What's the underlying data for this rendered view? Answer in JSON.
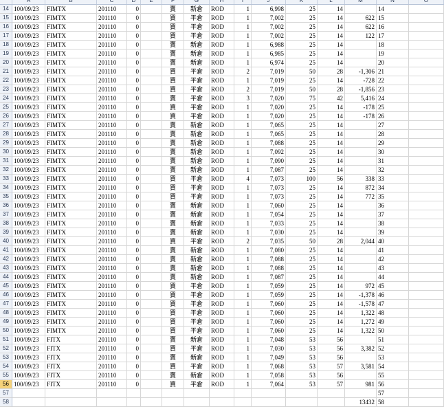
{
  "columns": [
    "A",
    "B",
    "C",
    "D",
    "E",
    "F",
    "G",
    "H",
    "I",
    "J",
    "K",
    "L",
    "M",
    "N",
    "O"
  ],
  "rows": [
    {
      "n": "14",
      "a": "100/09/23",
      "b": "FIMTX",
      "c": "201110",
      "d": "0",
      "f": "賣",
      "g": "新倉",
      "h": "ROD",
      "i": "1",
      "j": "6,998",
      "k": "25",
      "l": "14",
      "m": ""
    },
    {
      "n": "15",
      "a": "100/09/23",
      "b": "FIMTX",
      "c": "201110",
      "d": "0",
      "f": "買",
      "g": "平倉",
      "h": "ROD",
      "i": "1",
      "j": "7,002",
      "k": "25",
      "l": "14",
      "m": "622"
    },
    {
      "n": "16",
      "a": "100/09/23",
      "b": "FIMTX",
      "c": "201110",
      "d": "0",
      "f": "買",
      "g": "平倉",
      "h": "ROD",
      "i": "1",
      "j": "7,002",
      "k": "25",
      "l": "14",
      "m": "622"
    },
    {
      "n": "17",
      "a": "100/09/23",
      "b": "FIMTX",
      "c": "201110",
      "d": "0",
      "f": "買",
      "g": "平倉",
      "h": "ROD",
      "i": "1",
      "j": "7,002",
      "k": "25",
      "l": "14",
      "m": "122"
    },
    {
      "n": "18",
      "a": "100/09/23",
      "b": "FIMTX",
      "c": "201110",
      "d": "0",
      "f": "賣",
      "g": "新倉",
      "h": "ROD",
      "i": "1",
      "j": "6,988",
      "k": "25",
      "l": "14",
      "m": ""
    },
    {
      "n": "19",
      "a": "100/09/23",
      "b": "FIMTX",
      "c": "201110",
      "d": "0",
      "f": "賣",
      "g": "新倉",
      "h": "ROD",
      "i": "1",
      "j": "6,985",
      "k": "25",
      "l": "14",
      "m": ""
    },
    {
      "n": "20",
      "a": "100/09/23",
      "b": "FIMTX",
      "c": "201110",
      "d": "0",
      "f": "賣",
      "g": "新倉",
      "h": "ROD",
      "i": "1",
      "j": "6,974",
      "k": "25",
      "l": "14",
      "m": ""
    },
    {
      "n": "21",
      "a": "100/09/23",
      "b": "FIMTX",
      "c": "201110",
      "d": "0",
      "f": "買",
      "g": "平倉",
      "h": "ROD",
      "i": "2",
      "j": "7,019",
      "k": "50",
      "l": "28",
      "m": "-1,306"
    },
    {
      "n": "22",
      "a": "100/09/23",
      "b": "FIMTX",
      "c": "201110",
      "d": "0",
      "f": "買",
      "g": "平倉",
      "h": "ROD",
      "i": "1",
      "j": "7,019",
      "k": "25",
      "l": "14",
      "m": "-728"
    },
    {
      "n": "23",
      "a": "100/09/23",
      "b": "FIMTX",
      "c": "201110",
      "d": "0",
      "f": "買",
      "g": "平倉",
      "h": "ROD",
      "i": "2",
      "j": "7,019",
      "k": "50",
      "l": "28",
      "m": "-1,856"
    },
    {
      "n": "24",
      "a": "100/09/23",
      "b": "FIMTX",
      "c": "201110",
      "d": "0",
      "f": "賣",
      "g": "平倉",
      "h": "ROD",
      "i": "3",
      "j": "7,020",
      "k": "75",
      "l": "42",
      "m": "5,416"
    },
    {
      "n": "25",
      "a": "100/09/23",
      "b": "FIMTX",
      "c": "201110",
      "d": "0",
      "f": "買",
      "g": "平倉",
      "h": "ROD",
      "i": "1",
      "j": "7,020",
      "k": "25",
      "l": "14",
      "m": "-178"
    },
    {
      "n": "26",
      "a": "100/09/23",
      "b": "FIMTX",
      "c": "201110",
      "d": "0",
      "f": "買",
      "g": "平倉",
      "h": "ROD",
      "i": "1",
      "j": "7,020",
      "k": "25",
      "l": "14",
      "m": "-178"
    },
    {
      "n": "27",
      "a": "100/09/23",
      "b": "FIMTX",
      "c": "201110",
      "d": "0",
      "f": "賣",
      "g": "新倉",
      "h": "ROD",
      "i": "1",
      "j": "7,065",
      "k": "25",
      "l": "14",
      "m": ""
    },
    {
      "n": "28",
      "a": "100/09/23",
      "b": "FIMTX",
      "c": "201110",
      "d": "0",
      "f": "賣",
      "g": "新倉",
      "h": "ROD",
      "i": "1",
      "j": "7,065",
      "k": "25",
      "l": "14",
      "m": ""
    },
    {
      "n": "29",
      "a": "100/09/23",
      "b": "FIMTX",
      "c": "201110",
      "d": "0",
      "f": "賣",
      "g": "新倉",
      "h": "ROD",
      "i": "1",
      "j": "7,088",
      "k": "25",
      "l": "14",
      "m": ""
    },
    {
      "n": "30",
      "a": "100/09/23",
      "b": "FIMTX",
      "c": "201110",
      "d": "0",
      "f": "賣",
      "g": "新倉",
      "h": "ROD",
      "i": "1",
      "j": "7,092",
      "k": "25",
      "l": "14",
      "m": ""
    },
    {
      "n": "31",
      "a": "100/09/23",
      "b": "FIMTX",
      "c": "201110",
      "d": "0",
      "f": "賣",
      "g": "新倉",
      "h": "ROD",
      "i": "1",
      "j": "7,090",
      "k": "25",
      "l": "14",
      "m": ""
    },
    {
      "n": "32",
      "a": "100/09/23",
      "b": "FIMTX",
      "c": "201110",
      "d": "0",
      "f": "賣",
      "g": "新倉",
      "h": "ROD",
      "i": "1",
      "j": "7,087",
      "k": "25",
      "l": "14",
      "m": ""
    },
    {
      "n": "33",
      "a": "100/09/23",
      "b": "FIMTX",
      "c": "201110",
      "d": "0",
      "f": "買",
      "g": "平倉",
      "h": "ROD",
      "i": "4",
      "j": "7,073",
      "k": "100",
      "l": "56",
      "m": "338"
    },
    {
      "n": "34",
      "a": "100/09/23",
      "b": "FIMTX",
      "c": "201110",
      "d": "0",
      "f": "買",
      "g": "平倉",
      "h": "ROD",
      "i": "1",
      "j": "7,073",
      "k": "25",
      "l": "14",
      "m": "872"
    },
    {
      "n": "35",
      "a": "100/09/23",
      "b": "FIMTX",
      "c": "201110",
      "d": "0",
      "f": "買",
      "g": "平倉",
      "h": "ROD",
      "i": "1",
      "j": "7,073",
      "k": "25",
      "l": "14",
      "m": "772"
    },
    {
      "n": "36",
      "a": "100/09/23",
      "b": "FIMTX",
      "c": "201110",
      "d": "0",
      "f": "賣",
      "g": "新倉",
      "h": "ROD",
      "i": "1",
      "j": "7,060",
      "k": "25",
      "l": "14",
      "m": ""
    },
    {
      "n": "37",
      "a": "100/09/23",
      "b": "FIMTX",
      "c": "201110",
      "d": "0",
      "f": "賣",
      "g": "新倉",
      "h": "ROD",
      "i": "1",
      "j": "7,054",
      "k": "25",
      "l": "14",
      "m": ""
    },
    {
      "n": "38",
      "a": "100/09/23",
      "b": "FIMTX",
      "c": "201110",
      "d": "0",
      "f": "賣",
      "g": "新倉",
      "h": "ROD",
      "i": "1",
      "j": "7,033",
      "k": "25",
      "l": "14",
      "m": ""
    },
    {
      "n": "39",
      "a": "100/09/23",
      "b": "FIMTX",
      "c": "201110",
      "d": "0",
      "f": "賣",
      "g": "新倉",
      "h": "ROD",
      "i": "1",
      "j": "7,030",
      "k": "25",
      "l": "14",
      "m": ""
    },
    {
      "n": "40",
      "a": "100/09/23",
      "b": "FIMTX",
      "c": "201110",
      "d": "0",
      "f": "買",
      "g": "平倉",
      "h": "ROD",
      "i": "2",
      "j": "7,035",
      "k": "50",
      "l": "28",
      "m": "2,044"
    },
    {
      "n": "41",
      "a": "100/09/23",
      "b": "FIMTX",
      "c": "201110",
      "d": "0",
      "f": "賣",
      "g": "新倉",
      "h": "ROD",
      "i": "1",
      "j": "7,080",
      "k": "25",
      "l": "14",
      "m": ""
    },
    {
      "n": "42",
      "a": "100/09/23",
      "b": "FIMTX",
      "c": "201110",
      "d": "0",
      "f": "賣",
      "g": "新倉",
      "h": "ROD",
      "i": "1",
      "j": "7,088",
      "k": "25",
      "l": "14",
      "m": ""
    },
    {
      "n": "43",
      "a": "100/09/23",
      "b": "FIMTX",
      "c": "201110",
      "d": "0",
      "f": "賣",
      "g": "新倉",
      "h": "ROD",
      "i": "1",
      "j": "7,088",
      "k": "25",
      "l": "14",
      "m": ""
    },
    {
      "n": "44",
      "a": "100/09/23",
      "b": "FIMTX",
      "c": "201110",
      "d": "0",
      "f": "賣",
      "g": "新倉",
      "h": "ROD",
      "i": "1",
      "j": "7,087",
      "k": "25",
      "l": "14",
      "m": ""
    },
    {
      "n": "45",
      "a": "100/09/23",
      "b": "FIMTX",
      "c": "201110",
      "d": "0",
      "f": "買",
      "g": "平倉",
      "h": "ROD",
      "i": "1",
      "j": "7,059",
      "k": "25",
      "l": "14",
      "m": "972"
    },
    {
      "n": "46",
      "a": "100/09/23",
      "b": "FIMTX",
      "c": "201110",
      "d": "0",
      "f": "買",
      "g": "平倉",
      "h": "ROD",
      "i": "1",
      "j": "7,059",
      "k": "25",
      "l": "14",
      "m": "-1,378"
    },
    {
      "n": "47",
      "a": "100/09/23",
      "b": "FIMTX",
      "c": "201110",
      "d": "0",
      "f": "買",
      "g": "平倉",
      "h": "ROD",
      "i": "1",
      "j": "7,060",
      "k": "25",
      "l": "14",
      "m": "-1,578"
    },
    {
      "n": "48",
      "a": "100/09/23",
      "b": "FIMTX",
      "c": "201110",
      "d": "0",
      "f": "買",
      "g": "平倉",
      "h": "ROD",
      "i": "1",
      "j": "7,060",
      "k": "25",
      "l": "14",
      "m": "1,322"
    },
    {
      "n": "49",
      "a": "100/09/23",
      "b": "FIMTX",
      "c": "201110",
      "d": "0",
      "f": "買",
      "g": "平倉",
      "h": "ROD",
      "i": "1",
      "j": "7,060",
      "k": "25",
      "l": "14",
      "m": "1,272"
    },
    {
      "n": "50",
      "a": "100/09/23",
      "b": "FIMTX",
      "c": "201110",
      "d": "0",
      "f": "買",
      "g": "平倉",
      "h": "ROD",
      "i": "1",
      "j": "7,060",
      "k": "25",
      "l": "14",
      "m": "1,322"
    },
    {
      "n": "51",
      "a": "100/09/23",
      "b": "FITX",
      "c": "201110",
      "d": "0",
      "f": "賣",
      "g": "新倉",
      "h": "ROD",
      "i": "1",
      "j": "7,048",
      "k": "53",
      "l": "56",
      "m": ""
    },
    {
      "n": "52",
      "a": "100/09/23",
      "b": "FITX",
      "c": "201110",
      "d": "0",
      "f": "買",
      "g": "平倉",
      "h": "ROD",
      "i": "1",
      "j": "7,030",
      "k": "53",
      "l": "56",
      "m": "3,382"
    },
    {
      "n": "53",
      "a": "100/09/23",
      "b": "FITX",
      "c": "201110",
      "d": "0",
      "f": "賣",
      "g": "新倉",
      "h": "ROD",
      "i": "1",
      "j": "7,049",
      "k": "53",
      "l": "56",
      "m": ""
    },
    {
      "n": "54",
      "a": "100/09/23",
      "b": "FITX",
      "c": "201110",
      "d": "0",
      "f": "買",
      "g": "平倉",
      "h": "ROD",
      "i": "1",
      "j": "7,068",
      "k": "53",
      "l": "57",
      "m": "3,581"
    },
    {
      "n": "55",
      "a": "100/09/23",
      "b": "FITX",
      "c": "201110",
      "d": "0",
      "f": "賣",
      "g": "新倉",
      "h": "ROD",
      "i": "1",
      "j": "7,058",
      "k": "53",
      "l": "56",
      "m": ""
    },
    {
      "n": "56",
      "a": "100/09/23",
      "b": "FITX",
      "c": "201110",
      "d": "0",
      "f": "買",
      "g": "平倉",
      "h": "ROD",
      "i": "1",
      "j": "7,064",
      "k": "53",
      "l": "57",
      "m": "981",
      "selected": true
    },
    {
      "n": "57",
      "a": "",
      "b": "",
      "c": "",
      "d": "",
      "f": "",
      "g": "",
      "h": "",
      "i": "",
      "j": "",
      "k": "",
      "l": "",
      "m": ""
    },
    {
      "n": "58",
      "a": "",
      "b": "",
      "c": "",
      "d": "",
      "f": "",
      "g": "",
      "h": "",
      "i": "",
      "j": "",
      "k": "",
      "l": "",
      "m": "13432"
    }
  ]
}
